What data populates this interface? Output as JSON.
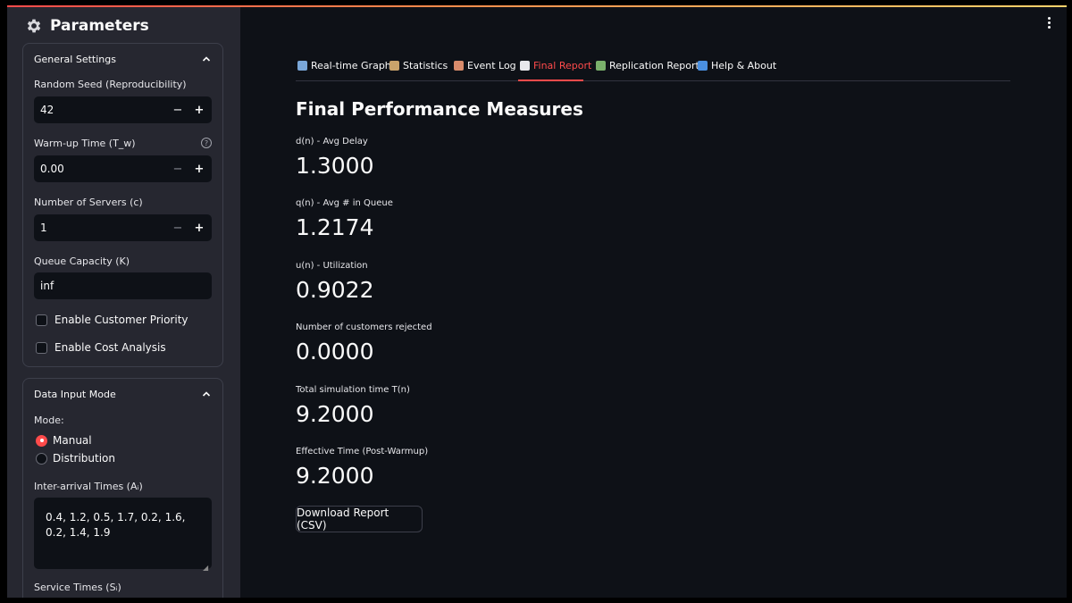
{
  "sidebar": {
    "title": "Parameters",
    "general": {
      "header": "General Settings",
      "random_seed": {
        "label": "Random Seed (Reproducibility)",
        "value": "42"
      },
      "warmup": {
        "label": "Warm-up Time (T_w)",
        "value": "0.00"
      },
      "servers": {
        "label": "Number of Servers (c)",
        "value": "1"
      },
      "capacity": {
        "label": "Queue Capacity (K)",
        "value": "inf"
      },
      "priority": {
        "label": "Enable Customer Priority",
        "checked": false
      },
      "cost": {
        "label": "Enable Cost Analysis",
        "checked": false
      }
    },
    "data_input": {
      "header": "Data Input Mode",
      "mode_label": "Mode:",
      "options": [
        "Manual",
        "Distribution"
      ],
      "selected": "Manual",
      "interarrival_label": "Inter-arrival Times (Aᵢ)",
      "interarrival_value": "0.4, 1.2, 0.5, 1.7, 0.2, 1.6, 0.2, 1.4, 1.9",
      "service_label": "Service Times (Sᵢ)"
    }
  },
  "tabs": [
    {
      "label": "Real-time Graph",
      "icon": "chart-icon",
      "color": "#7aa7d9"
    },
    {
      "label": "Statistics",
      "icon": "clipboard-icon",
      "color": "#c9a36b"
    },
    {
      "label": "Event Log",
      "icon": "log-icon",
      "color": "#d98b6b"
    },
    {
      "label": "Final Report",
      "icon": "document-icon",
      "color": "#e8e8ec"
    },
    {
      "label": "Replication Report",
      "icon": "bar-chart-icon",
      "color": "#7ab06b"
    },
    {
      "label": "Help & About",
      "icon": "info-icon",
      "color": "#4a8fe0"
    }
  ],
  "active_tab": "Final Report",
  "main": {
    "title": "Final Performance Measures",
    "metrics": [
      {
        "label": "d(n) - Avg Delay",
        "value": "1.3000"
      },
      {
        "label": "q(n) - Avg # in Queue",
        "value": "1.2174"
      },
      {
        "label": "u(n) - Utilization",
        "value": "0.9022"
      },
      {
        "label": "Number of customers rejected",
        "value": "0.0000"
      },
      {
        "label": "Total simulation time T(n)",
        "value": "9.2000"
      },
      {
        "label": "Effective Time (Post-Warmup)",
        "value": "9.2000"
      }
    ],
    "download_label": "Download Report (CSV)"
  },
  "colors": {
    "accent": "#ff4b4b",
    "background": "#0e1117",
    "sidebar": "#262730"
  }
}
